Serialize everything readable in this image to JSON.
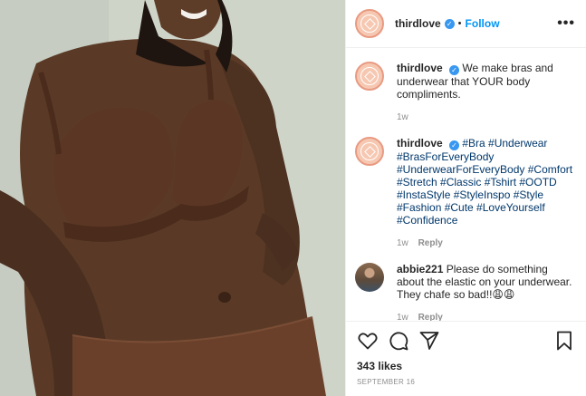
{
  "header": {
    "username": "thirdlove",
    "separator": "•",
    "follow_label": "Follow",
    "more_label": "•••"
  },
  "comments": [
    {
      "username": "thirdlove",
      "text": "We make bras and underwear that YOUR body compliments.",
      "time": "1w",
      "reply": ""
    },
    {
      "username": "thirdlove",
      "text": "#Bra #Underwear #BrasForEveryBody #UnderwearForEveryBody #Comfort #Stretch #Classic #Tshirt #OOTD #InstaStyle #StyleInspo #Style #Fashion #Cute #LoveYourself #Confidence",
      "time": "1w",
      "reply": "Reply"
    },
    {
      "username": "abbie221",
      "text": "Please do something about the elastic on your underwear. They chafe so bad!!😩😩",
      "time": "1w",
      "reply": "Reply"
    }
  ],
  "actions": {
    "likes": "343 likes",
    "date": "SEPTEMBER 16"
  },
  "icons": [
    "heart-icon",
    "comment-icon",
    "share-icon",
    "bookmark-icon",
    "verified-badge-icon"
  ],
  "colors": {
    "link": "#0095f6",
    "verified": "#3897f0",
    "hashtag": "#00376b",
    "muted": "#8e8e8e"
  }
}
